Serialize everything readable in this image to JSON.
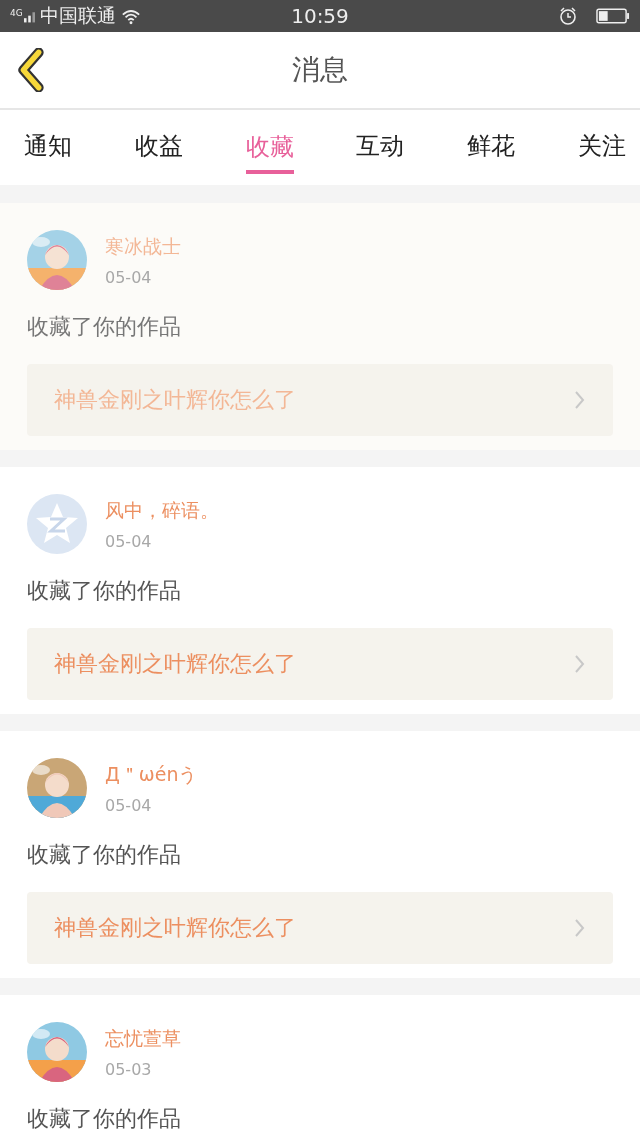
{
  "status_bar": {
    "network": "4G",
    "carrier": "中国联通",
    "time": "10:59"
  },
  "header": {
    "title": "消息"
  },
  "tabs": [
    {
      "label": "通知",
      "selected": false
    },
    {
      "label": "收益",
      "selected": false
    },
    {
      "label": "收藏",
      "selected": true
    },
    {
      "label": "互动",
      "selected": false
    },
    {
      "label": "鲜花",
      "selected": false
    },
    {
      "label": "关注",
      "selected": false
    }
  ],
  "items": [
    {
      "user": "寒冰战士",
      "date": "05-04",
      "action": "收藏了你的作品",
      "work": "神兽金刚之叶辉你怎么了",
      "pressed": true,
      "kind": "picture"
    },
    {
      "user": "风中，碎语。",
      "date": "05-04",
      "action": "收藏了你的作品",
      "work": "神兽金刚之叶辉你怎么了",
      "pressed": false,
      "kind": "default"
    },
    {
      "user": "Д＂ωénう",
      "date": "05-04",
      "action": "收藏了你的作品",
      "work": "神兽金刚之叶辉你怎么了",
      "pressed": false,
      "kind": "picture"
    },
    {
      "user": "忘忧萱草",
      "date": "05-03",
      "action": "收藏了你的作品",
      "pressed": false,
      "kind": "picture"
    }
  ]
}
